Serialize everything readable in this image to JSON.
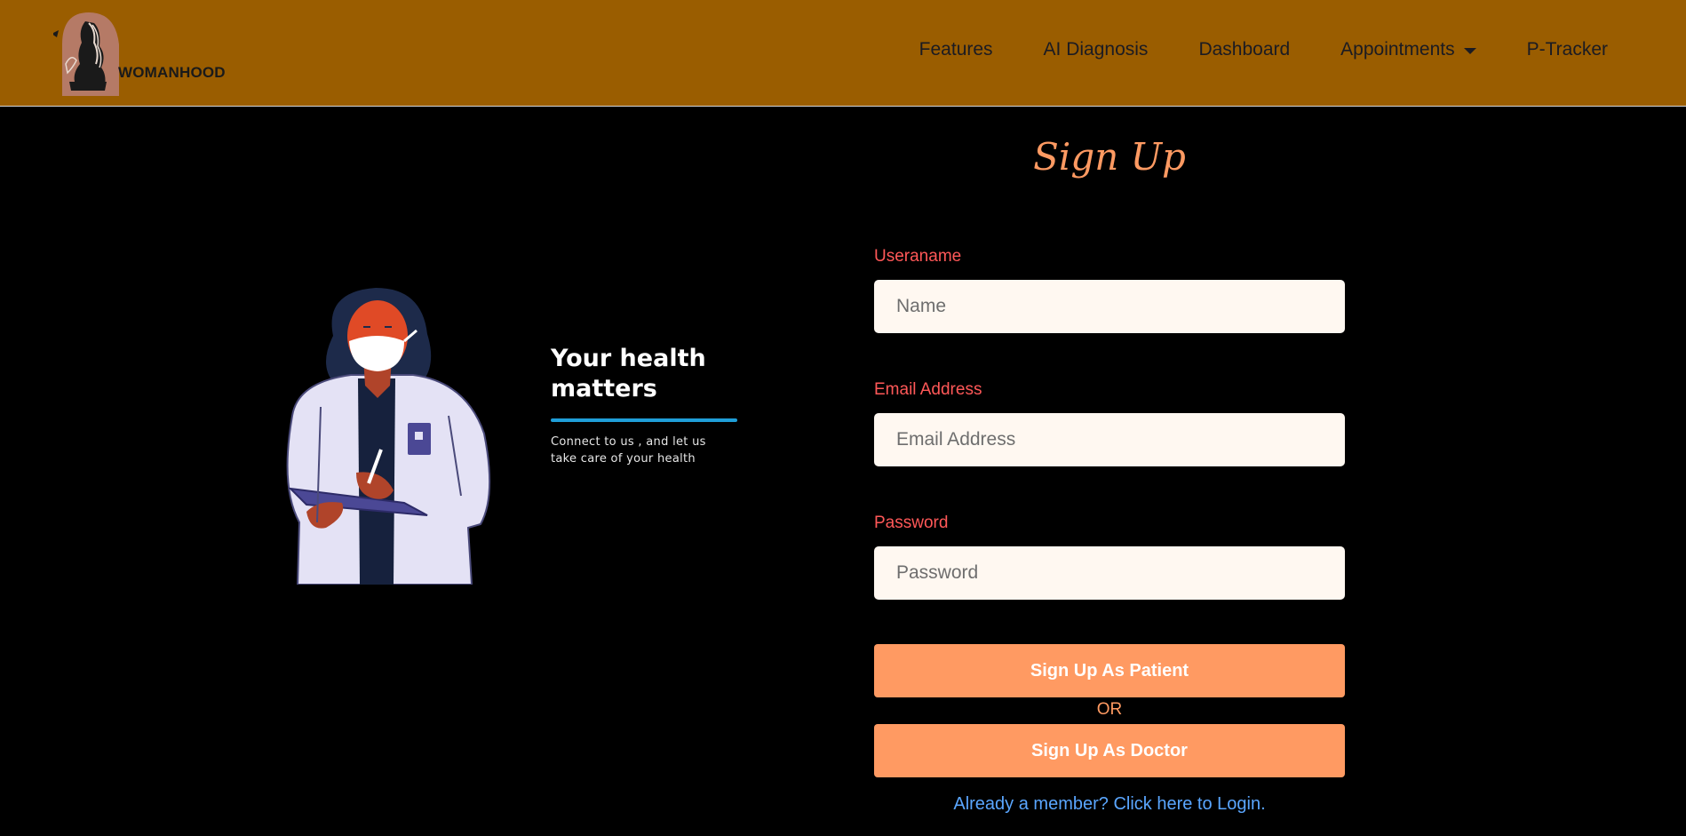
{
  "brand": {
    "name": "WOMANHOOD"
  },
  "nav": {
    "items": [
      {
        "label": "Features"
      },
      {
        "label": "AI Diagnosis"
      },
      {
        "label": "Dashboard"
      },
      {
        "label": "Appointments"
      },
      {
        "label": "P-Tracker"
      }
    ]
  },
  "hero": {
    "title": "Your health matters",
    "subtitle": "Connect to us , and let us take care of your health"
  },
  "form": {
    "title": "Sign Up",
    "username": {
      "label": "Useraname",
      "placeholder": "Name",
      "value": ""
    },
    "email": {
      "label": "Email Address",
      "placeholder": "Email Address",
      "value": ""
    },
    "password": {
      "label": "Password",
      "placeholder": "Password",
      "value": ""
    },
    "patient_button": "Sign Up As Patient",
    "or_text": "OR",
    "doctor_button": "Sign Up As Doctor",
    "login_link": "Already a member? Click here to Login."
  },
  "colors": {
    "navbar": "#9a5d00",
    "accent": "#ff9a62",
    "label": "#ff5858",
    "link": "#5aa6ff",
    "rule": "#1f9ed8"
  }
}
